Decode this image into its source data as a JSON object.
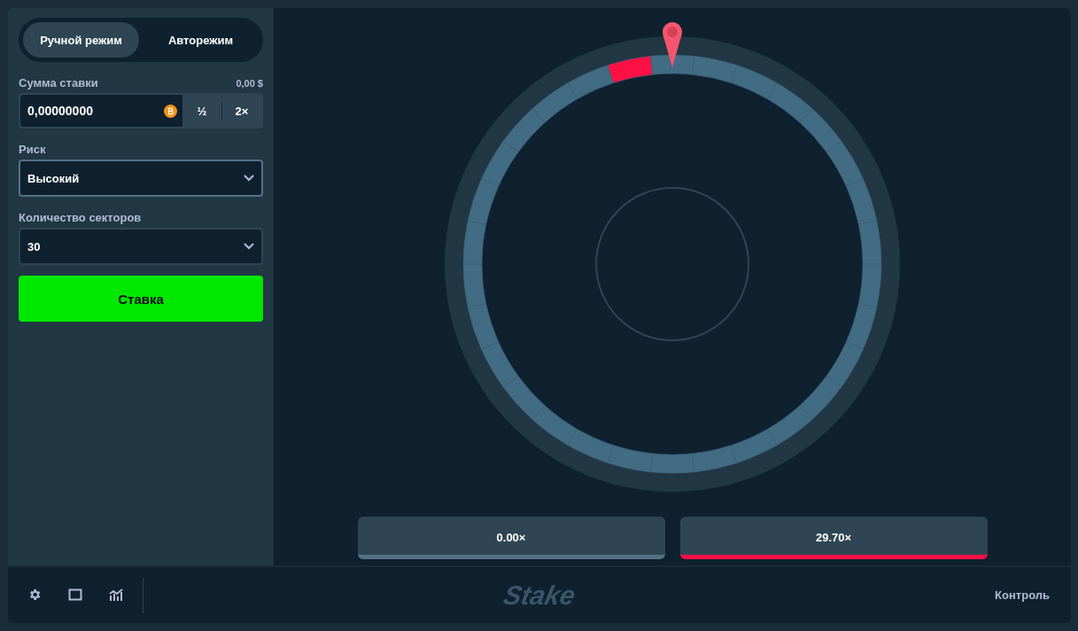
{
  "mode_tabs": [
    {
      "label": "Ручной режим",
      "selected": true
    },
    {
      "label": "Авторежим",
      "selected": false
    }
  ],
  "bet": {
    "label": "Сумма ставки",
    "usd": "0,00 $",
    "value": "0,00000000",
    "half": "½",
    "double": "2×"
  },
  "risk": {
    "label": "Риск",
    "value": "Высокий"
  },
  "segments_select": {
    "label": "Количество секторов",
    "value": "30"
  },
  "bet_button": "Ставка",
  "wheel": {
    "segments": [
      {
        "color": "#426b84"
      },
      {
        "color": "#426b84"
      },
      {
        "color": "#426b84"
      },
      {
        "color": "#426b84"
      },
      {
        "color": "#426b84"
      },
      {
        "color": "#426b84"
      },
      {
        "color": "#426b84"
      },
      {
        "color": "#426b84"
      },
      {
        "color": "#426b84"
      },
      {
        "color": "#426b84"
      },
      {
        "color": "#426b84"
      },
      {
        "color": "#426b84"
      },
      {
        "color": "#426b84"
      },
      {
        "color": "#426b84"
      },
      {
        "color": "#426b84"
      },
      {
        "color": "#426b84"
      },
      {
        "color": "#426b84"
      },
      {
        "color": "#426b84"
      },
      {
        "color": "#426b84"
      },
      {
        "color": "#426b84"
      },
      {
        "color": "#426b84"
      },
      {
        "color": "#426b84"
      },
      {
        "color": "#426b84"
      },
      {
        "color": "#426b84"
      },
      {
        "color": "#426b84"
      },
      {
        "color": "#426b84"
      },
      {
        "color": "#426b84"
      },
      {
        "color": "#426b84"
      },
      {
        "color": "#426b84"
      },
      {
        "color": "#fe1044"
      }
    ]
  },
  "payouts": [
    {
      "label": "0.00×",
      "color": "#557086"
    },
    {
      "label": "29.70×",
      "color": "#fe1044"
    }
  ],
  "footer": {
    "logo": "Stake",
    "control": "Контроль"
  }
}
